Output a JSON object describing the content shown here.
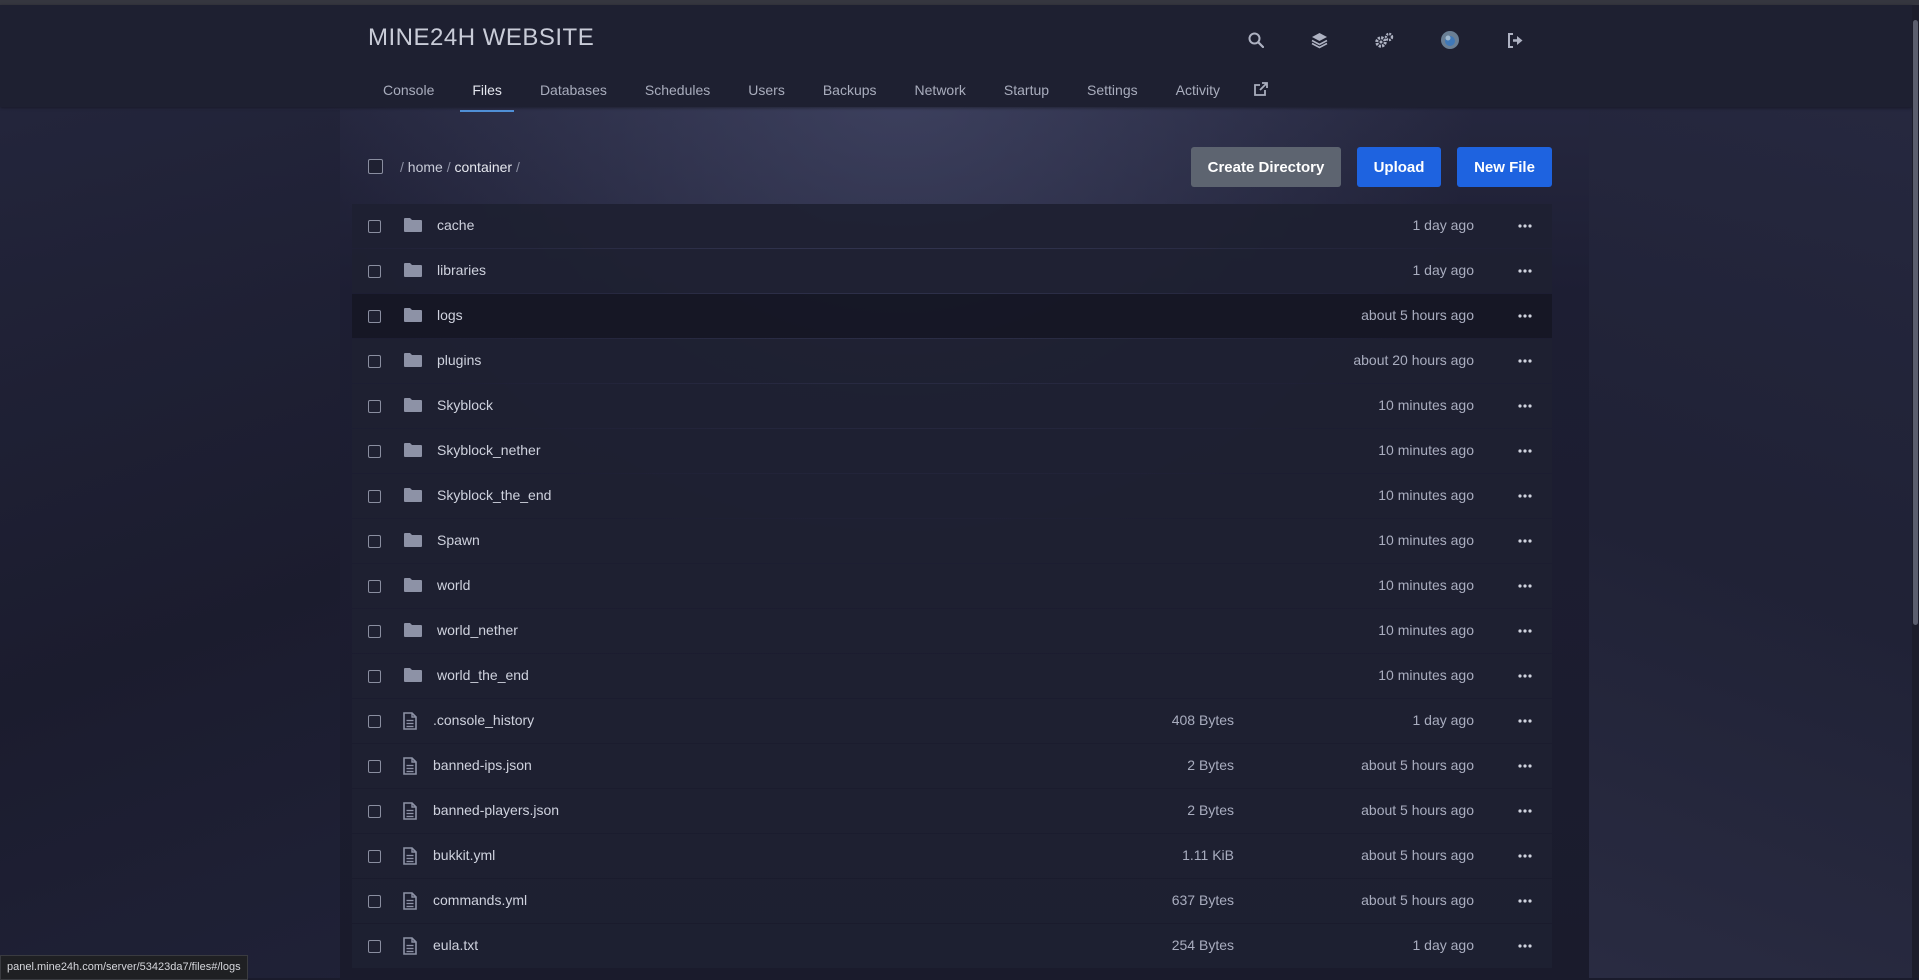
{
  "header": {
    "title": "MINE24H WEBSITE",
    "icons": [
      "search-icon",
      "layers-icon",
      "cogs-icon",
      "avatar",
      "sign-out-icon"
    ]
  },
  "nav": {
    "items": [
      {
        "label": "Console"
      },
      {
        "label": "Files",
        "active": true
      },
      {
        "label": "Databases"
      },
      {
        "label": "Schedules"
      },
      {
        "label": "Users"
      },
      {
        "label": "Backups"
      },
      {
        "label": "Network"
      },
      {
        "label": "Startup"
      },
      {
        "label": "Settings"
      },
      {
        "label": "Activity"
      }
    ],
    "external_icon": "external-link-icon"
  },
  "breadcrumb": {
    "sep": "/",
    "home": "home",
    "container": "container"
  },
  "toolbar": {
    "create_directory": "Create Directory",
    "upload": "Upload",
    "new_file": "New File"
  },
  "files": [
    {
      "type": "folder",
      "name": "cache",
      "size": "",
      "modified": "1 day ago"
    },
    {
      "type": "folder",
      "name": "libraries",
      "size": "",
      "modified": "1 day ago"
    },
    {
      "type": "folder",
      "name": "logs",
      "size": "",
      "modified": "about 5 hours ago"
    },
    {
      "type": "folder",
      "name": "plugins",
      "size": "",
      "modified": "about 20 hours ago"
    },
    {
      "type": "folder",
      "name": "Skyblock",
      "size": "",
      "modified": "10 minutes ago"
    },
    {
      "type": "folder",
      "name": "Skyblock_nether",
      "size": "",
      "modified": "10 minutes ago"
    },
    {
      "type": "folder",
      "name": "Skyblock_the_end",
      "size": "",
      "modified": "10 minutes ago"
    },
    {
      "type": "folder",
      "name": "Spawn",
      "size": "",
      "modified": "10 minutes ago"
    },
    {
      "type": "folder",
      "name": "world",
      "size": "",
      "modified": "10 minutes ago"
    },
    {
      "type": "folder",
      "name": "world_nether",
      "size": "",
      "modified": "10 minutes ago"
    },
    {
      "type": "folder",
      "name": "world_the_end",
      "size": "",
      "modified": "10 minutes ago"
    },
    {
      "type": "file",
      "name": ".console_history",
      "size": "408 Bytes",
      "modified": "1 day ago"
    },
    {
      "type": "file",
      "name": "banned-ips.json",
      "size": "2 Bytes",
      "modified": "about 5 hours ago"
    },
    {
      "type": "file",
      "name": "banned-players.json",
      "size": "2 Bytes",
      "modified": "about 5 hours ago"
    },
    {
      "type": "file",
      "name": "bukkit.yml",
      "size": "1.11 KiB",
      "modified": "about 5 hours ago"
    },
    {
      "type": "file",
      "name": "commands.yml",
      "size": "637 Bytes",
      "modified": "about 5 hours ago"
    },
    {
      "type": "file",
      "name": "eula.txt",
      "size": "254 Bytes",
      "modified": "1 day ago"
    }
  ],
  "hovered_row": "logs",
  "status_bar": {
    "url": "panel.mine24h.com/server/53423da7/files#/logs"
  }
}
